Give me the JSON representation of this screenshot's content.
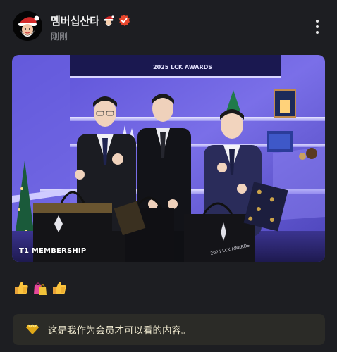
{
  "post": {
    "username": "멤버십산타",
    "timestamp": "刚刚",
    "watermark": "T1 MEMBERSHIP",
    "photo_banner": "2025 LCK AWARDS",
    "members_only_text": "这是我作为会员才可以看的内容。"
  },
  "icons": {
    "avatar": "santa-avatar",
    "name_emoji": "santa-emoji",
    "badge": "verified-badge",
    "more": "more-vertical-icon",
    "reactions": [
      "thumbs-up-emoji",
      "shopping-bags-emoji",
      "thumbs-up-emoji"
    ],
    "members": "diamond-icon"
  },
  "colors": {
    "background": "#1d1e22",
    "verified": "#e8472d",
    "members_box": "#2b2b27",
    "diamond": "#f2c230"
  }
}
